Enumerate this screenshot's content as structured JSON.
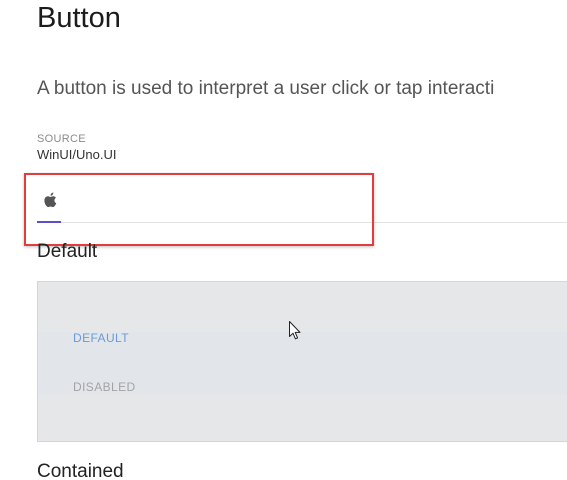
{
  "page": {
    "title": "Button",
    "description": "A button is used to interpret a user click or tap interacti"
  },
  "source": {
    "label": "SOURCE",
    "value": "WinUI/Uno.UI"
  },
  "tabs": [
    {
      "icon": "apple-icon",
      "selected": true
    }
  ],
  "colors": {
    "accent": "#5b4fd1",
    "highlight": "#e23c3c",
    "button_default_text": "#6b9bd6",
    "button_disabled_text": "#a3a3a3"
  },
  "sections": {
    "default": {
      "heading": "Default",
      "buttons": {
        "default_label": "DEFAULT",
        "disabled_label": "DISABLED"
      }
    },
    "contained": {
      "heading": "Contained"
    }
  }
}
